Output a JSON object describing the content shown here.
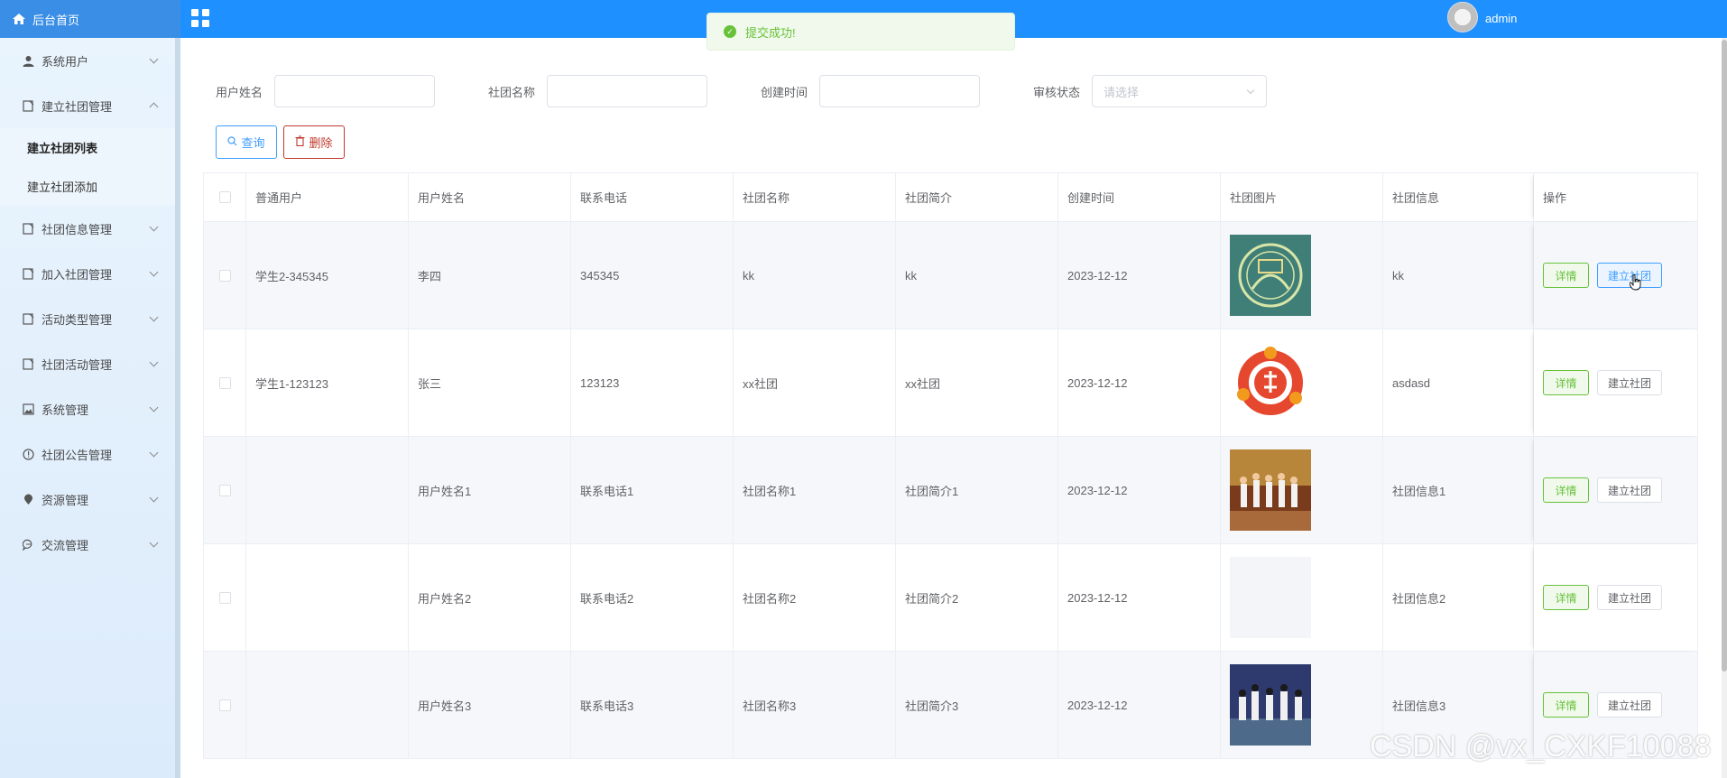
{
  "header": {
    "home_label": "后台首页",
    "system_title": "",
    "user_name": "admin"
  },
  "toast": {
    "message": "提交成功!"
  },
  "sidebar": {
    "items": [
      {
        "label": "系统用户",
        "icon": "user-icon"
      },
      {
        "label": "建立社团管理",
        "icon": "document-icon",
        "expanded": true,
        "children": [
          {
            "label": "建立社团列表",
            "active": true
          },
          {
            "label": "建立社团添加"
          }
        ]
      },
      {
        "label": "社团信息管理",
        "icon": "document-icon"
      },
      {
        "label": "加入社团管理",
        "icon": "document-icon"
      },
      {
        "label": "活动类型管理",
        "icon": "document-icon"
      },
      {
        "label": "社团活动管理",
        "icon": "document-icon"
      },
      {
        "label": "系统管理",
        "icon": "image-icon"
      },
      {
        "label": "社团公告管理",
        "icon": "info-icon"
      },
      {
        "label": "资源管理",
        "icon": "location-icon"
      },
      {
        "label": "交流管理",
        "icon": "chat-icon"
      }
    ]
  },
  "filters": {
    "user_name_label": "用户姓名",
    "club_name_label": "社团名称",
    "created_label": "创建时间",
    "review_label": "审核状态",
    "review_placeholder": "请选择"
  },
  "actions": {
    "query_label": "查询",
    "delete_label": "删除"
  },
  "table": {
    "headers": [
      "普通用户",
      "用户姓名",
      "联系电话",
      "社团名称",
      "社团简介",
      "创建时间",
      "社团图片",
      "社团信息",
      "操作"
    ],
    "detail_label": "详情",
    "build_label": "建立社团",
    "rows": [
      {
        "user": "学生2-345345",
        "name": "李四",
        "phone": "345345",
        "club": "kk",
        "intro": "kk",
        "date": "2023-12-12",
        "image": "teal-logo",
        "info": "kk"
      },
      {
        "user": "学生1-123123",
        "name": "张三",
        "phone": "123123",
        "club": "xx社团",
        "intro": "xx社团",
        "date": "2023-12-12",
        "image": "orange-logo",
        "info": "asdasd"
      },
      {
        "user": "",
        "name": "用户姓名1",
        "phone": "联系电话1",
        "club": "社团名称1",
        "intro": "社团简介1",
        "date": "2023-12-12",
        "image": "stage-photo",
        "info": "社团信息1"
      },
      {
        "user": "",
        "name": "用户姓名2",
        "phone": "联系电话2",
        "club": "社团名称2",
        "intro": "社团简介2",
        "date": "2023-12-12",
        "image": "blank",
        "info": "社团信息2"
      },
      {
        "user": "",
        "name": "用户姓名3",
        "phone": "联系电话3",
        "club": "社团名称3",
        "intro": "社团简介3",
        "date": "2023-12-12",
        "image": "dance-photo",
        "info": "社团信息3"
      }
    ]
  },
  "watermark": "CSDN @vx_CXKF10088",
  "colors": {
    "primary": "#1e90ff",
    "success": "#67c23a",
    "danger": "#c0392b"
  }
}
